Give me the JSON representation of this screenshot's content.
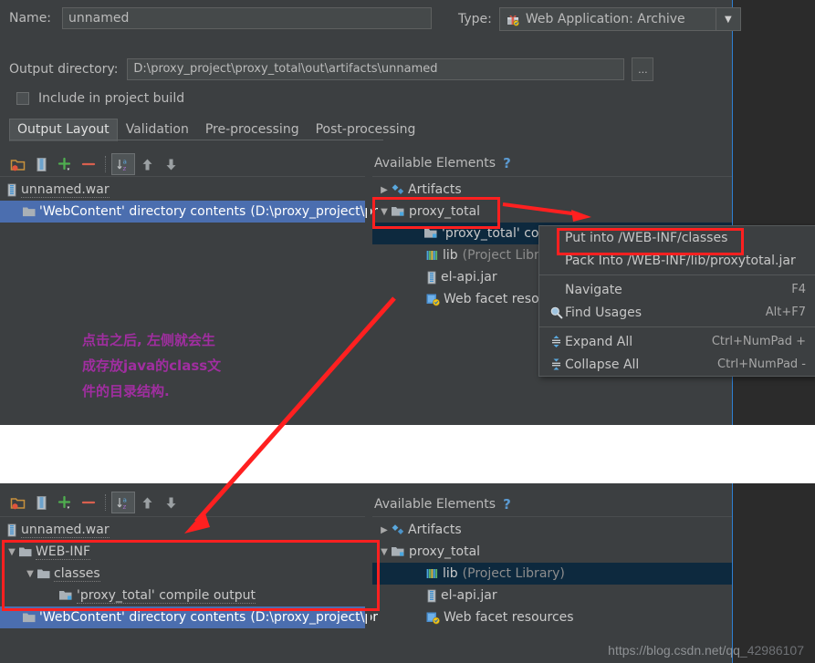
{
  "form": {
    "name_label": "Name:",
    "name_value": "unnamed",
    "type_label": "Type:",
    "type_value": "Web Application: Archive",
    "type_icon": "archive-gift-icon",
    "outdir_label": "Output directory:",
    "outdir_value": "D:\\proxy_project\\proxy_total\\out\\artifacts\\unnamed",
    "browse_label": "...",
    "include_label": "Include in project build"
  },
  "tabs": [
    {
      "label": "Output Layout",
      "active": true
    },
    {
      "label": "Validation",
      "active": false
    },
    {
      "label": "Pre-processing",
      "active": false
    },
    {
      "label": "Post-processing",
      "active": false
    }
  ],
  "toolbar": {
    "buttons": [
      {
        "name": "add-directory-icon",
        "title": "Create Directory"
      },
      {
        "name": "add-archive-icon",
        "title": "Create Archive"
      },
      {
        "name": "add-icon",
        "title": "Add"
      },
      {
        "name": "remove-icon",
        "title": "Remove"
      },
      {
        "name": "sort-alphabetically-icon",
        "title": "Sort by name"
      },
      {
        "name": "move-up-icon",
        "title": "Move Up"
      },
      {
        "name": "move-down-icon",
        "title": "Move Down"
      }
    ]
  },
  "available": {
    "header": "Available Elements",
    "help": "?"
  },
  "top_panel": {
    "output_tree": [
      {
        "indent": 0,
        "twisty": "",
        "icon": "archive-icon",
        "label": "unnamed.war",
        "dim": "",
        "selected": false
      },
      {
        "indent": 1,
        "twisty": "",
        "icon": "folder-icon",
        "label": "'WebContent' directory contents",
        "dim": "(D:\\proxy_project\\pr",
        "selected": true
      }
    ],
    "available_tree": [
      {
        "indent": 0,
        "twisty": "▶",
        "icon": "artifacts-icon",
        "label": "Artifacts",
        "dim": "",
        "selected": false
      },
      {
        "indent": 0,
        "twisty": "▼",
        "icon": "module-icon",
        "label": "proxy_total",
        "dim": "",
        "selected": false
      },
      {
        "indent": 1,
        "twisty": "",
        "icon": "module-icon",
        "label": "'proxy_total' co",
        "dim": "",
        "selected": true
      },
      {
        "indent": 1,
        "twisty": "",
        "icon": "library-icon",
        "label": "lib",
        "dim": "(Project Libr",
        "selected": false
      },
      {
        "indent": 1,
        "twisty": "",
        "icon": "jar-icon",
        "label": "el-api.jar",
        "dim": "",
        "selected": false
      },
      {
        "indent": 1,
        "twisty": "",
        "icon": "web-facet-icon",
        "label": "Web facet resou",
        "dim": "",
        "selected": false
      }
    ]
  },
  "context_menu": {
    "items": [
      {
        "label": "Put into /WEB-INF/classes",
        "shortcut": "",
        "icon": "",
        "highlighted": true
      },
      {
        "label": "Pack Into /WEB-INF/lib/proxytotal.jar",
        "shortcut": "",
        "icon": "",
        "highlighted": false
      },
      {
        "separator": true
      },
      {
        "label": "Navigate",
        "shortcut": "F4",
        "icon": "",
        "highlighted": false
      },
      {
        "label": "Find Usages",
        "shortcut": "Alt+F7",
        "icon": "search-icon",
        "highlighted": false
      },
      {
        "separator": true
      },
      {
        "label": "Expand All",
        "shortcut": "Ctrl+NumPad +",
        "icon": "expand-all-icon",
        "highlighted": false
      },
      {
        "label": "Collapse All",
        "shortcut": "Ctrl+NumPad -",
        "icon": "collapse-all-icon",
        "highlighted": false
      }
    ]
  },
  "bottom_panel": {
    "output_tree": [
      {
        "indent": 0,
        "twisty": "",
        "icon": "archive-icon",
        "label": "unnamed.war",
        "dim": "",
        "selected": false
      },
      {
        "indent": 0,
        "twisty": "▼",
        "icon": "folder-icon",
        "label": "WEB-INF",
        "dim": "",
        "selected": false
      },
      {
        "indent": 1,
        "twisty": "▼",
        "icon": "folder-icon",
        "label": "classes",
        "dim": "",
        "selected": false
      },
      {
        "indent": 2,
        "twisty": "",
        "icon": "module-icon",
        "label": "'proxy_total' compile output",
        "dim": "",
        "selected": false
      },
      {
        "indent": 1,
        "twisty": "",
        "icon": "folder-icon",
        "label": "'WebContent' directory contents",
        "dim": "(D:\\proxy_project\\pr",
        "selected": true
      }
    ],
    "available_tree": [
      {
        "indent": 0,
        "twisty": "▶",
        "icon": "artifacts-icon",
        "label": "Artifacts",
        "dim": "",
        "selected": false
      },
      {
        "indent": 0,
        "twisty": "▼",
        "icon": "module-icon",
        "label": "proxy_total",
        "dim": "",
        "selected": false
      },
      {
        "indent": 1,
        "twisty": "",
        "icon": "library-icon",
        "label": "lib",
        "dim": "(Project Library)",
        "selected": true
      },
      {
        "indent": 1,
        "twisty": "",
        "icon": "jar-icon",
        "label": "el-api.jar",
        "dim": "",
        "selected": false
      },
      {
        "indent": 1,
        "twisty": "",
        "icon": "web-facet-icon",
        "label": "Web facet resources",
        "dim": "",
        "selected": false
      }
    ]
  },
  "annotations": {
    "note_line1": "点击之后, 左侧就会生",
    "note_line2": "成存放java的class文",
    "note_line3": "件的目录结构.",
    "note_color": "#a02ea0",
    "highlight_color": "#ff2020"
  },
  "watermark": {
    "url_visible": "https://blog.csdn.net/qq",
    "url_faded": "_42986107"
  }
}
